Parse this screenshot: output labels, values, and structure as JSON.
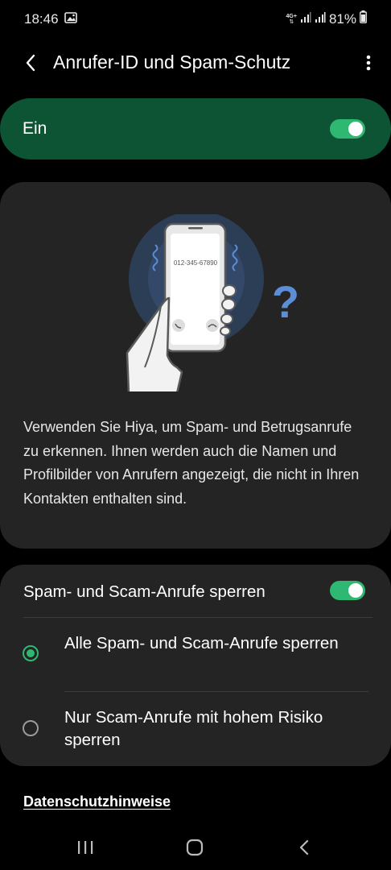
{
  "status_bar": {
    "time": "18:46",
    "network": "4G+",
    "battery": "81%"
  },
  "app_bar": {
    "title": "Anrufer-ID und Spam-Schutz"
  },
  "master_switch": {
    "label": "Ein",
    "on": true
  },
  "info": {
    "phone_number": "012-345-67890",
    "question_mark": "?",
    "description": "Verwenden Sie Hiya, um Spam- und Betrugsanrufe zu erkennen. Ihnen werden auch die Namen und Profilbilder von Anrufern angezeigt, die nicht in Ihren Kontakten enthalten sind."
  },
  "block_spam": {
    "title": "Spam- und Scam-Anrufe sperren",
    "on": true,
    "options": [
      {
        "label": "Alle Spam- und Scam-Anrufe sperren",
        "selected": true
      },
      {
        "label": "Nur Scam-Anrufe mit hohem Risiko sperren",
        "selected": false
      }
    ]
  },
  "privacy_link": "Datenschutzhinweise",
  "colors": {
    "accent": "#2fb872",
    "master_bg": "#0d5435",
    "card_bg": "#242424",
    "illustration_blue": "#5b8ed6"
  }
}
